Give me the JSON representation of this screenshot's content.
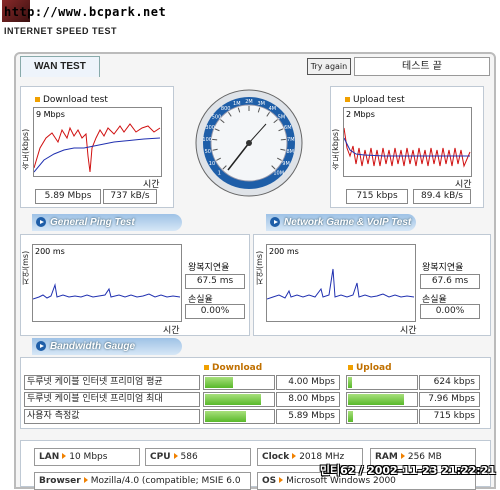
{
  "header": {
    "url": "http://www.bcpark.net",
    "subtitle": "INTERNET SPEED TEST"
  },
  "tabs": {
    "wan": "WAN TEST"
  },
  "controls": {
    "try_again": "Try again",
    "status": "테스트 끝"
  },
  "download": {
    "title": "Download test",
    "y_axis": "속도(kbps)",
    "scale": "9 Mbps",
    "x_axis": "시간",
    "mbps": "5.89 Mbps",
    "kbs": "737 kB/s"
  },
  "upload": {
    "title": "Upload test",
    "y_axis": "속도(kbps)",
    "scale": "2 Mbps",
    "x_axis": "시간",
    "kbps": "715 kbps",
    "kbs": "89.4 kB/s"
  },
  "gauge": {
    "ticks": [
      "1",
      "10",
      "50",
      "100",
      "300",
      "500",
      "800",
      "1M",
      "2M",
      "3M",
      "4M",
      "5M",
      "6M",
      "7M",
      "8M",
      "9M",
      "10M"
    ]
  },
  "ping": {
    "title": "General Ping Test",
    "y_axis": "지연(ms)",
    "scale": "200 ms",
    "x_axis": "시간",
    "latency_label": "왕복지연율",
    "latency": "67.5 ms",
    "loss_label": "손실율",
    "loss": "0.00%"
  },
  "voip": {
    "title": "Network Game & VoIP Test",
    "y_axis": "지연(ms)",
    "scale": "200 ms",
    "x_axis": "시간",
    "latency_label": "왕복지연율",
    "latency": "67.6 ms",
    "loss_label": "손실율",
    "loss": "0.00%"
  },
  "bandwidth": {
    "title": "Bandwidth Gauge",
    "download_label": "Download",
    "upload_label": "Upload",
    "rows": [
      {
        "name": "두루넷 케이블 인터넷 프리미엄 평균",
        "down": "4.00 Mbps",
        "down_frac": 0.4,
        "up": "624 kbps",
        "up_frac": 0.06
      },
      {
        "name": "두루넷 케이블 인터넷 프리미엄 최대",
        "down": "8.00 Mbps",
        "down_frac": 0.8,
        "up": "7.96 Mbps",
        "up_frac": 0.8
      },
      {
        "name": "사용자 측정값",
        "down": "5.89 Mbps",
        "down_frac": 0.59,
        "up": "715 kbps",
        "up_frac": 0.07
      }
    ]
  },
  "system": {
    "lan_label": "LAN",
    "lan": "10 Mbps",
    "cpu_label": "CPU",
    "cpu": "586",
    "clock_label": "Clock",
    "clock": "2018 MHz",
    "ram_label": "RAM",
    "ram": "256 MB",
    "browser_label": "Browser",
    "browser": "Mozilla/4.0 (compatible; MSIE 6.0",
    "os_label": "OS",
    "os": "Microsoft Windows 2000"
  },
  "footer": {
    "timestamp": "민티62 / 2002-11-23 21:22:21"
  },
  "colors": {
    "download_line": "#d01010",
    "avg_line": "#2030b0",
    "ping_line": "#2030b0",
    "bar_fill": "#58b82a",
    "accent": "#1e5ea8"
  }
}
